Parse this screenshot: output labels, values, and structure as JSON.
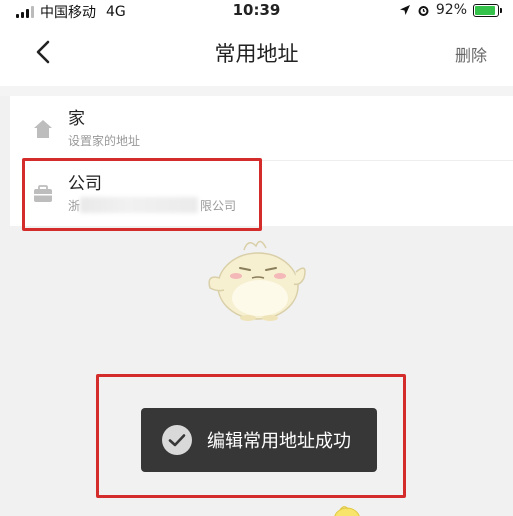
{
  "status_bar": {
    "carrier": "中国移动",
    "network": "4G",
    "time": "10:39",
    "battery": "92%",
    "battery_level": 0.92,
    "battery_color": "#35c24a"
  },
  "nav": {
    "back_icon": "chevron-left-icon",
    "title": "常用地址",
    "action_label": "删除"
  },
  "addresses": [
    {
      "name": "家",
      "detail": "设置家的地址",
      "icon": "home-icon"
    },
    {
      "name": "公司",
      "detail_prefix": "浙",
      "detail_suffix": "限公司",
      "icon": "briefcase-icon"
    }
  ],
  "toast": {
    "icon": "check-circle-icon",
    "message": "编辑常用地址成功"
  },
  "colors": {
    "highlight": "#d42b2b",
    "toast_bg": "#373737",
    "page_bg": "#f1f1f1"
  }
}
